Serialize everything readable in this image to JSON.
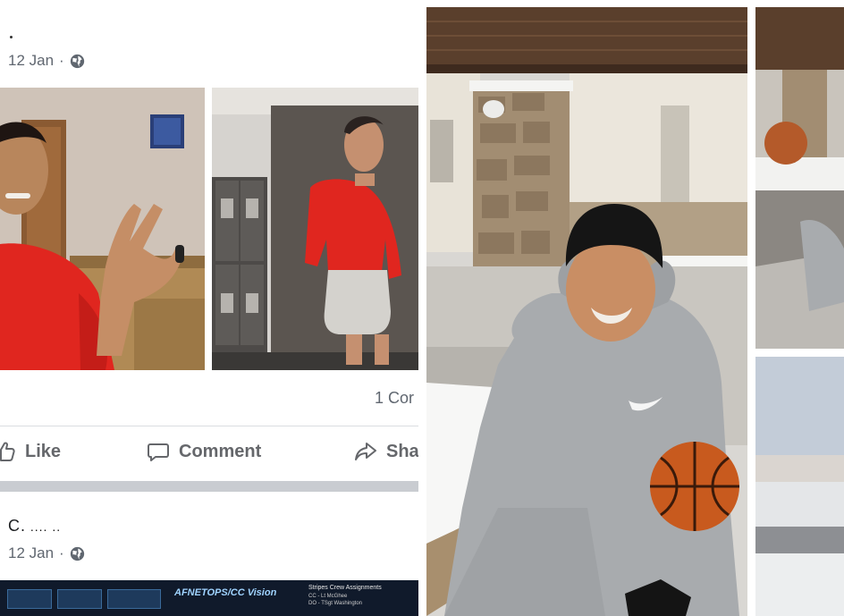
{
  "post1": {
    "date": "12 Jan",
    "separator": "·",
    "privacy_icon": "globe-icon"
  },
  "post1_stats": {
    "comments_count": "1 Cor"
  },
  "actions": {
    "like": {
      "label": "Like",
      "icon": "thumbs-up-icon"
    },
    "comment": {
      "label": "Comment",
      "icon": "comment-bubble-icon"
    },
    "share": {
      "label": "Sha",
      "icon": "share-arrow-icon"
    }
  },
  "post2": {
    "author": "C.",
    "author_trailing": "  ....     ..",
    "date": "12 Jan",
    "separator": "·",
    "privacy_icon": "globe-icon"
  },
  "banner": {
    "title": "AFNETOPS/CC Vision",
    "side_title": "Stripes Crew Assignments",
    "side_line1": "CC - Lt McGhee",
    "side_line2": "DO - TSgt Washington"
  },
  "colors": {
    "feed_bg": "#ffffff",
    "divider": "#c9ccd1",
    "text_muted": "#606770",
    "action_text": "#65676b",
    "shirt_red": "#e0261f",
    "hoodie_gray": "#a8abae"
  }
}
